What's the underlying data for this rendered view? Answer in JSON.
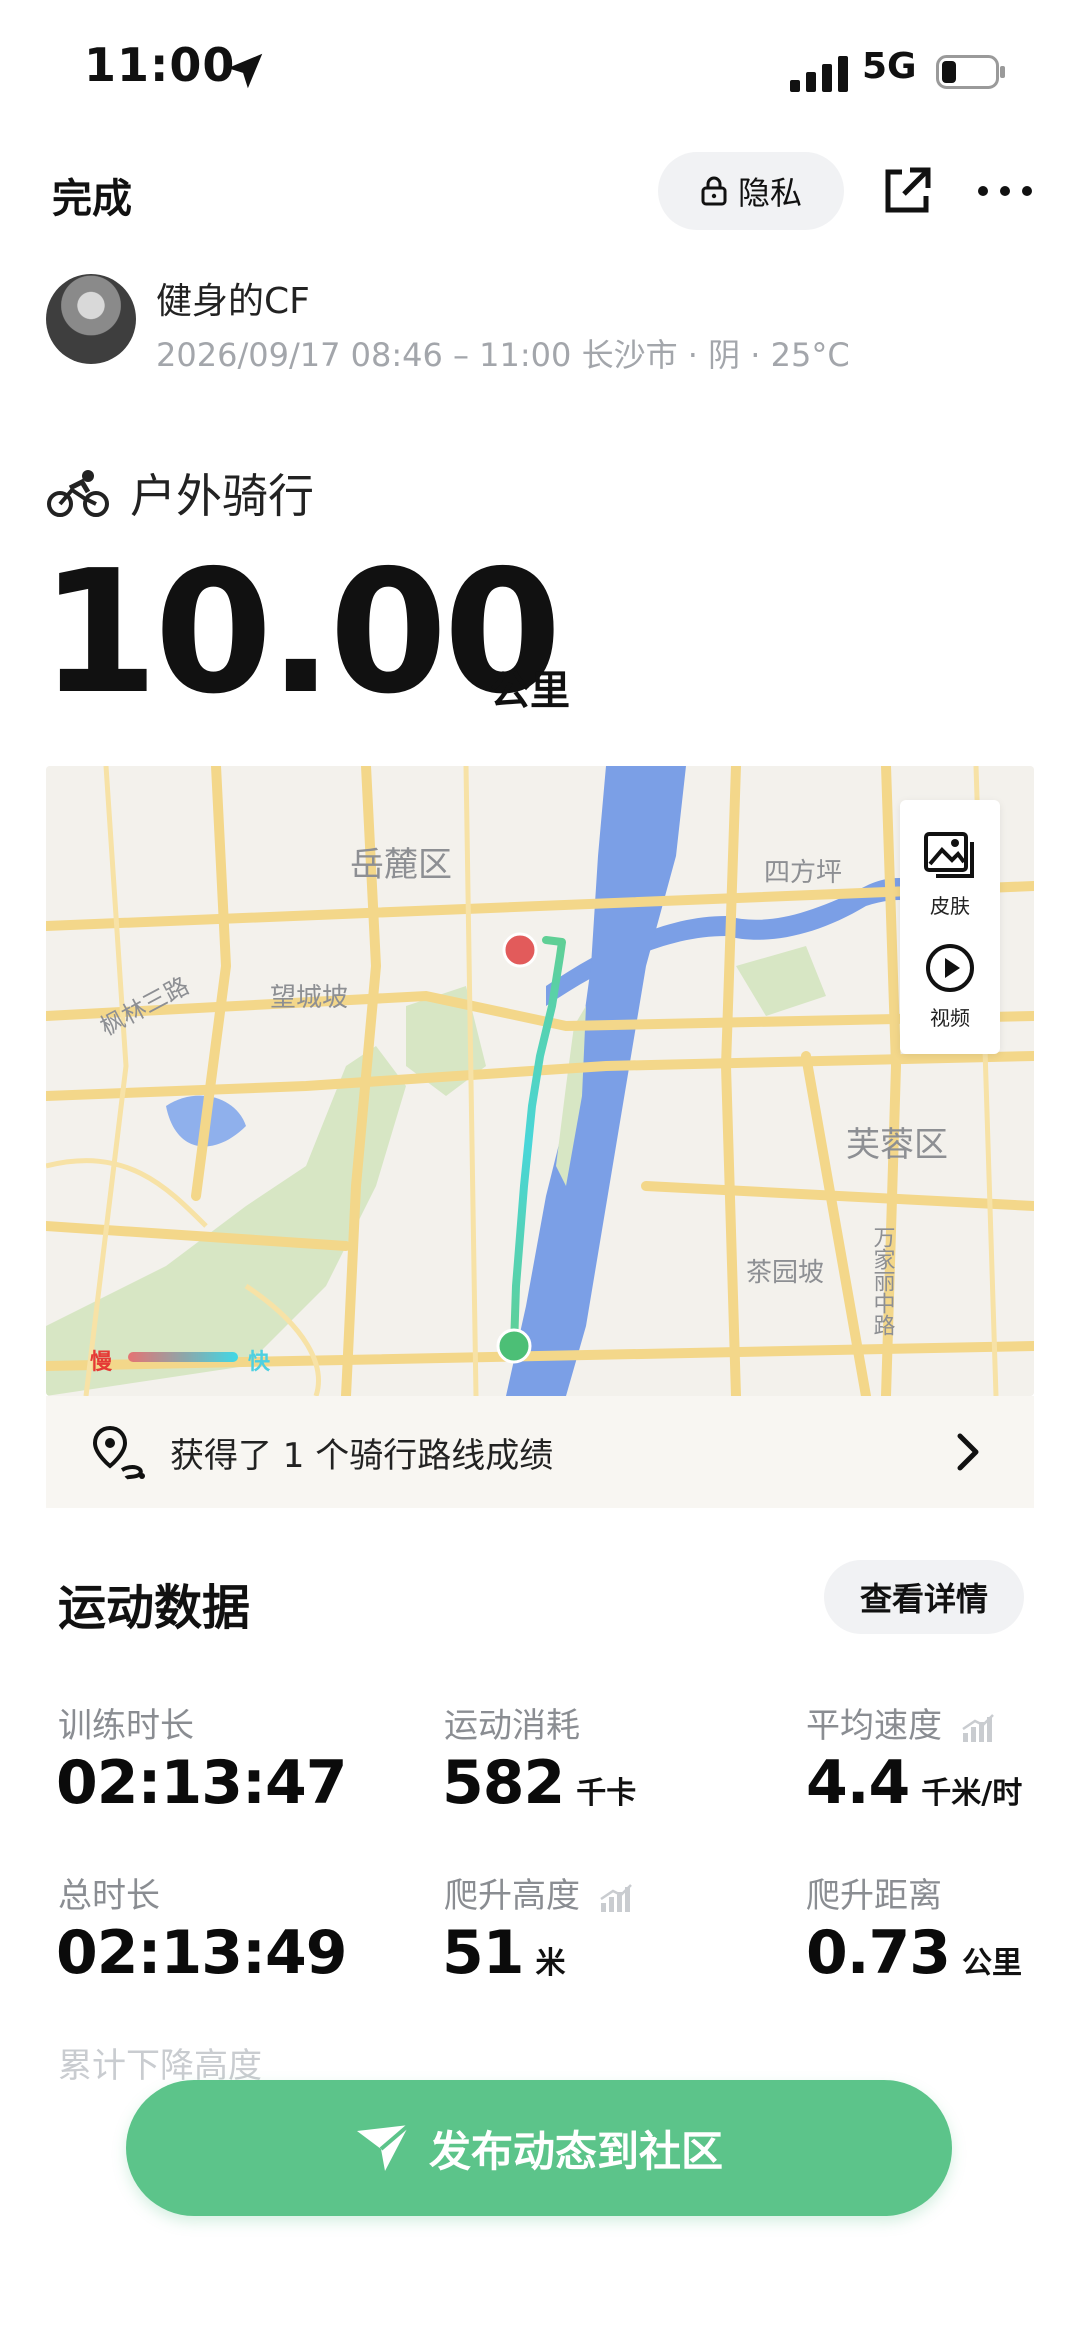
{
  "status_bar": {
    "time": "11:00",
    "network": "5G"
  },
  "header": {
    "done_label": "完成",
    "privacy_label": "隐私"
  },
  "user": {
    "name": "健身的CF",
    "meta": "2026/09/17 08:46 – 11:00 长沙市 · 阴 · 25°C"
  },
  "activity": {
    "type": "户外骑行",
    "distance": "10.00",
    "distance_unit": "公里"
  },
  "map": {
    "labels": [
      "岳麓区",
      "四方坪",
      "望城坡",
      "枫林三路",
      "芙蓉区",
      "茶园坡",
      "万家丽中路"
    ],
    "side_buttons": [
      {
        "label": "皮肤"
      },
      {
        "label": "视频"
      }
    ],
    "legend": {
      "slow": "慢",
      "fast": "快"
    },
    "route_start_color": "#4cbf76",
    "route_end_color": "#e25b5b",
    "river_color": "#7b9fe6"
  },
  "route_achievement": {
    "text": "获得了 1 个骑行路线成绩"
  },
  "stats": {
    "title": "运动数据",
    "detail_label": "查看详情",
    "items": [
      {
        "label": "训练时长",
        "value": "02:13:47",
        "unit": ""
      },
      {
        "label": "运动消耗",
        "value": "582",
        "unit": "千卡"
      },
      {
        "label": "平均速度",
        "value": "4.4",
        "unit": "千米/时"
      },
      {
        "label": "总时长",
        "value": "02:13:49",
        "unit": ""
      },
      {
        "label": "爬升高度",
        "value": "51",
        "unit": "米"
      },
      {
        "label": "爬升距离",
        "value": "0.73",
        "unit": "公里"
      },
      {
        "label": "累计下降高度",
        "value": "",
        "unit": ""
      }
    ]
  },
  "publish": {
    "label": "发布动态到社区"
  },
  "colors": {
    "accent": "#5cc48a",
    "label_gray": "#8a8d92"
  }
}
